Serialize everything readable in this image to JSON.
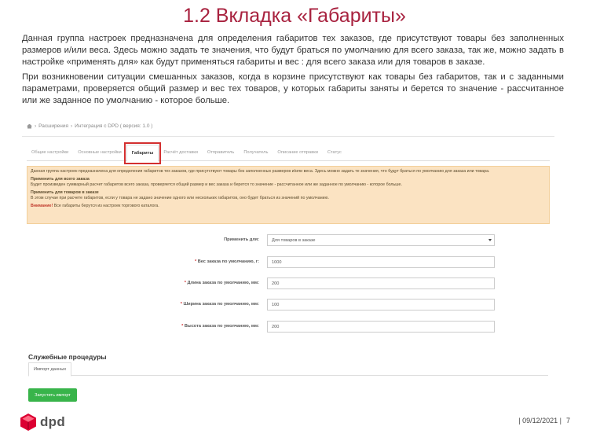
{
  "slide": {
    "title": "1.2 Вкладка «Габариты»",
    "paragraph1": "Данная группа настроек предназначена для определения габаритов тех заказов, где присутствуют товары без заполненных размеров и/или веса. Здесь можно задать те значения, что будут браться по умолчанию для всего заказа, так же, можно задать в настройке «применять для» как будут применяться габариты и вес : для всего заказа или для товаров в заказе.",
    "paragraph2": "При возникновении ситуации смешанных заказов, когда в корзине присутствуют как товары без габаритов, так и с заданными параметрами, проверяется общий размер и вес тех товаров, у которых габариты заняты и берется то значение - рассчитанное или же заданное по умолчанию - которое больше."
  },
  "screenshot": {
    "breadcrumb": [
      "Расширения",
      "Интеграция с DPD ( версия: 1.0 )"
    ],
    "tabs": [
      {
        "label": "Общие настройки"
      },
      {
        "label": "Основные настройки"
      },
      {
        "label": "Габариты",
        "active": true
      },
      {
        "label": "Расчёт доставки"
      },
      {
        "label": "Отправитель"
      },
      {
        "label": "Получатель"
      },
      {
        "label": "Описание отправки"
      },
      {
        "label": "Статус"
      }
    ],
    "notice": {
      "intro": "Данная группа настроек предназначена для определения габаритов тех заказов, где присутствуют товары без заполненных размеров и/или веса. Здесь можно задать те значения, что будут браться по умолчанию для заказа или товара.",
      "whole_title": "Применить для всего заказа",
      "whole_text": "Будет произведен суммарный расчет габаритов всего заказа, проверяется общий размер и вес заказа и берется то значение - рассчитанное или же заданное по умолчанию - которое больше.",
      "goods_title": "Применить для товаров в заказе",
      "goods_text": "В этом случае при расчете габаритов, если у товара не задано значение одного или нескольких габаритов, оно будет браться из значений по умолчанию.",
      "warn_label": "Внимание!",
      "warn_text": "Все габариты берутся из настроек торгового каталога."
    },
    "form": {
      "apply_label": "Применить для:",
      "apply_value": "Для товаров в заказе",
      "weight_label": "Вес заказа по умолчанию, г:",
      "weight_value": "1000",
      "length_label": "Длина заказа по умолчанию, мм:",
      "length_value": "200",
      "width_label": "Ширина заказа по умолчанию, мм:",
      "width_value": "100",
      "height_label": "Высота заказа по умолчанию, мм:",
      "height_value": "200"
    },
    "service": {
      "title": "Служебные процедуры",
      "tab": "Импорт данных",
      "button": "Запустить импорт"
    }
  },
  "footer": {
    "logo_text": "dpd",
    "date": "| 09/12/2021 |",
    "page": "7"
  },
  "colors": {
    "title": "#a8223f",
    "brand_red": "#dc0032",
    "notice_bg": "#fbe3c2",
    "button_green": "#38b44a",
    "active_tab_outline": "#d32f2f"
  }
}
